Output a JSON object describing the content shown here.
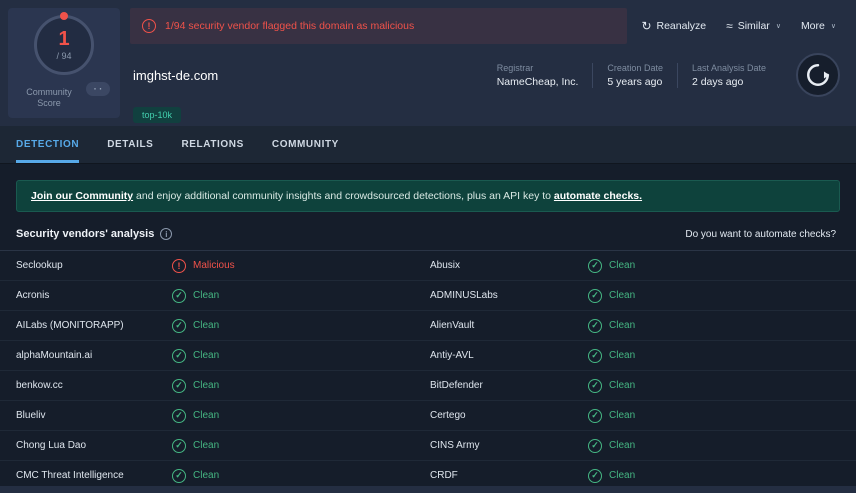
{
  "header": {
    "score": {
      "value": "1",
      "total": "/ 94",
      "label": "Community Score"
    },
    "alert": {
      "text": "1/94 security vendor flagged this domain as malicious"
    },
    "actions": {
      "reanalyze": "Reanalyze",
      "similar": "Similar",
      "more": "More"
    },
    "domain": "imghst-de.com",
    "meta": [
      {
        "label": "Registrar",
        "value": "NameCheap, Inc."
      },
      {
        "label": "Creation Date",
        "value": "5 years ago"
      },
      {
        "label": "Last Analysis Date",
        "value": "2 days ago"
      }
    ],
    "tags": [
      "top-10k"
    ]
  },
  "tabs": [
    {
      "label": "DETECTION",
      "active": true
    },
    {
      "label": "DETAILS",
      "active": false
    },
    {
      "label": "RELATIONS",
      "active": false
    },
    {
      "label": "COMMUNITY",
      "active": false
    }
  ],
  "community_banner": {
    "link1": "Join our Community",
    "middle": " and enjoy additional community insights and crowdsourced detections, plus an API key to ",
    "link2": "automate checks."
  },
  "analysis": {
    "title": "Security vendors' analysis",
    "automate_question": "Do you want to automate checks?",
    "rows": [
      [
        {
          "vendor": "Seclookup",
          "status": "Malicious",
          "malicious": true
        },
        {
          "vendor": "Abusix",
          "status": "Clean",
          "malicious": false
        }
      ],
      [
        {
          "vendor": "Acronis",
          "status": "Clean",
          "malicious": false
        },
        {
          "vendor": "ADMINUSLabs",
          "status": "Clean",
          "malicious": false
        }
      ],
      [
        {
          "vendor": "AILabs (MONITORAPP)",
          "status": "Clean",
          "malicious": false
        },
        {
          "vendor": "AlienVault",
          "status": "Clean",
          "malicious": false
        }
      ],
      [
        {
          "vendor": "alphaMountain.ai",
          "status": "Clean",
          "malicious": false
        },
        {
          "vendor": "Antiy-AVL",
          "status": "Clean",
          "malicious": false
        }
      ],
      [
        {
          "vendor": "benkow.cc",
          "status": "Clean",
          "malicious": false
        },
        {
          "vendor": "BitDefender",
          "status": "Clean",
          "malicious": false
        }
      ],
      [
        {
          "vendor": "Blueliv",
          "status": "Clean",
          "malicious": false
        },
        {
          "vendor": "Certego",
          "status": "Clean",
          "malicious": false
        }
      ],
      [
        {
          "vendor": "Chong Lua Dao",
          "status": "Clean",
          "malicious": false
        },
        {
          "vendor": "CINS Army",
          "status": "Clean",
          "malicious": false
        }
      ],
      [
        {
          "vendor": "CMC Threat Intelligence",
          "status": "Clean",
          "malicious": false
        },
        {
          "vendor": "CRDF",
          "status": "Clean",
          "malicious": false
        }
      ]
    ]
  },
  "icons": {
    "reanalyze": "↻",
    "similar": "≈",
    "chevron": "∨",
    "alert": "!",
    "clean": "✓",
    "malicious": "!",
    "info": "i"
  },
  "colors": {
    "malicious_red": "#f0524a",
    "clean_green": "#45b683",
    "accent_blue": "#57a9e8",
    "banner_teal": "#0e423c",
    "header_navy": "#242e42",
    "tag_teal": "#43cfae"
  }
}
